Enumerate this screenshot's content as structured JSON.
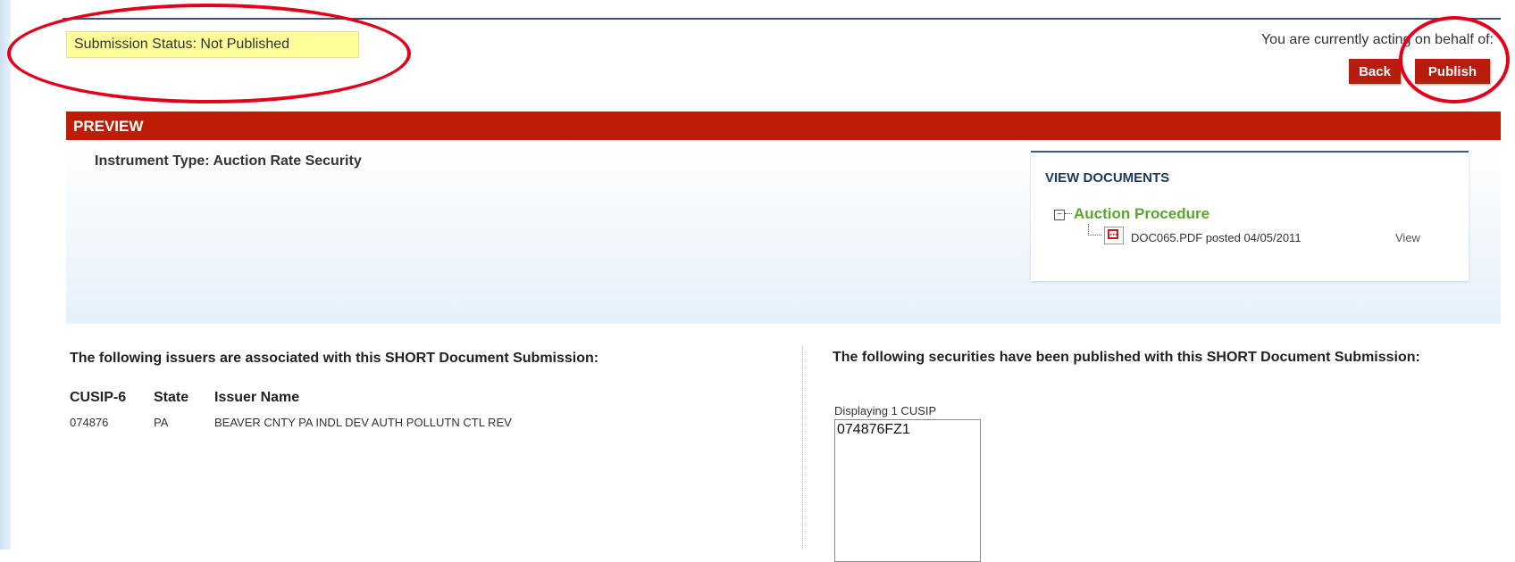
{
  "status": {
    "text": "Submission Status: Not Published"
  },
  "header": {
    "acting_text": "You are currently acting on behalf of:"
  },
  "buttons": {
    "back": "Back",
    "publish": "Publish"
  },
  "preview": {
    "bar_title": "PREVIEW",
    "instrument_type": "Instrument Type: Auction Rate Security"
  },
  "documents": {
    "title": "VIEW DOCUMENTS",
    "toggle_symbol": "−",
    "folder": "Auction Procedure",
    "file": "DOC065.PDF posted 04/05/2011",
    "view_link": "View",
    "file_icon": "pdf-icon"
  },
  "issuers": {
    "heading": "The following issuers are associated with this SHORT Document Submission:",
    "columns": [
      "CUSIP-6",
      "State",
      "Issuer Name"
    ],
    "rows": [
      {
        "cusip6": "074876",
        "state": "PA",
        "name": "BEAVER CNTY PA INDL DEV AUTH POLLUTN CTL REV"
      }
    ]
  },
  "securities": {
    "heading": "The following securities have been published with this SHORT Document Submission:",
    "displaying": "Displaying 1 CUSIP",
    "cusips": [
      "074876FZ1"
    ]
  },
  "colors": {
    "accent_red": "#bd1c06",
    "status_yellow": "#ffff99",
    "folder_green": "#5aa52e",
    "annotation_red": "#e4001b"
  }
}
